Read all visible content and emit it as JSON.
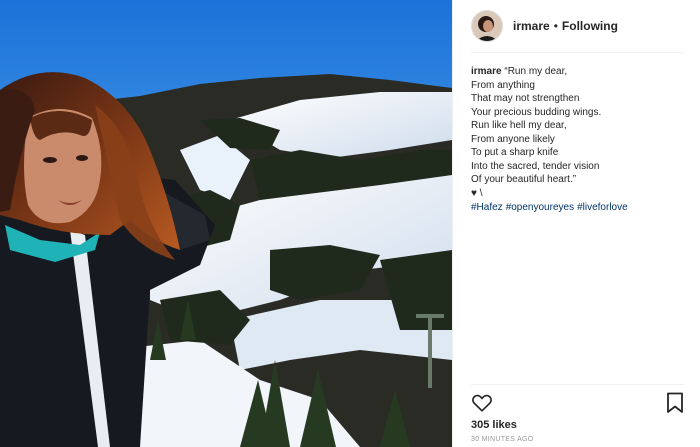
{
  "post": {
    "username": "irmare",
    "separator": "•",
    "follow_status": "Following",
    "caption": {
      "username": "irmare",
      "lines": [
        "“Run my dear,",
        "From anything",
        "That may not strengthen",
        "Your precious budding wings.",
        "Run like hell my dear,",
        "From anyone likely",
        "To put a sharp knife",
        "Into the sacred, tender vision",
        "Of your beautiful heart.”",
        "♥ \\"
      ],
      "hashtags": [
        "#Hafez",
        "#openyoureyes",
        "#liveforlove"
      ]
    },
    "likes": "305 likes",
    "timestamp": "30 MINUTES AGO"
  },
  "icons": {
    "like": "heart-icon",
    "save": "bookmark-icon"
  },
  "colors": {
    "text": "#262626",
    "hashtag": "#003569",
    "muted": "#999999",
    "divider": "#efefef"
  }
}
